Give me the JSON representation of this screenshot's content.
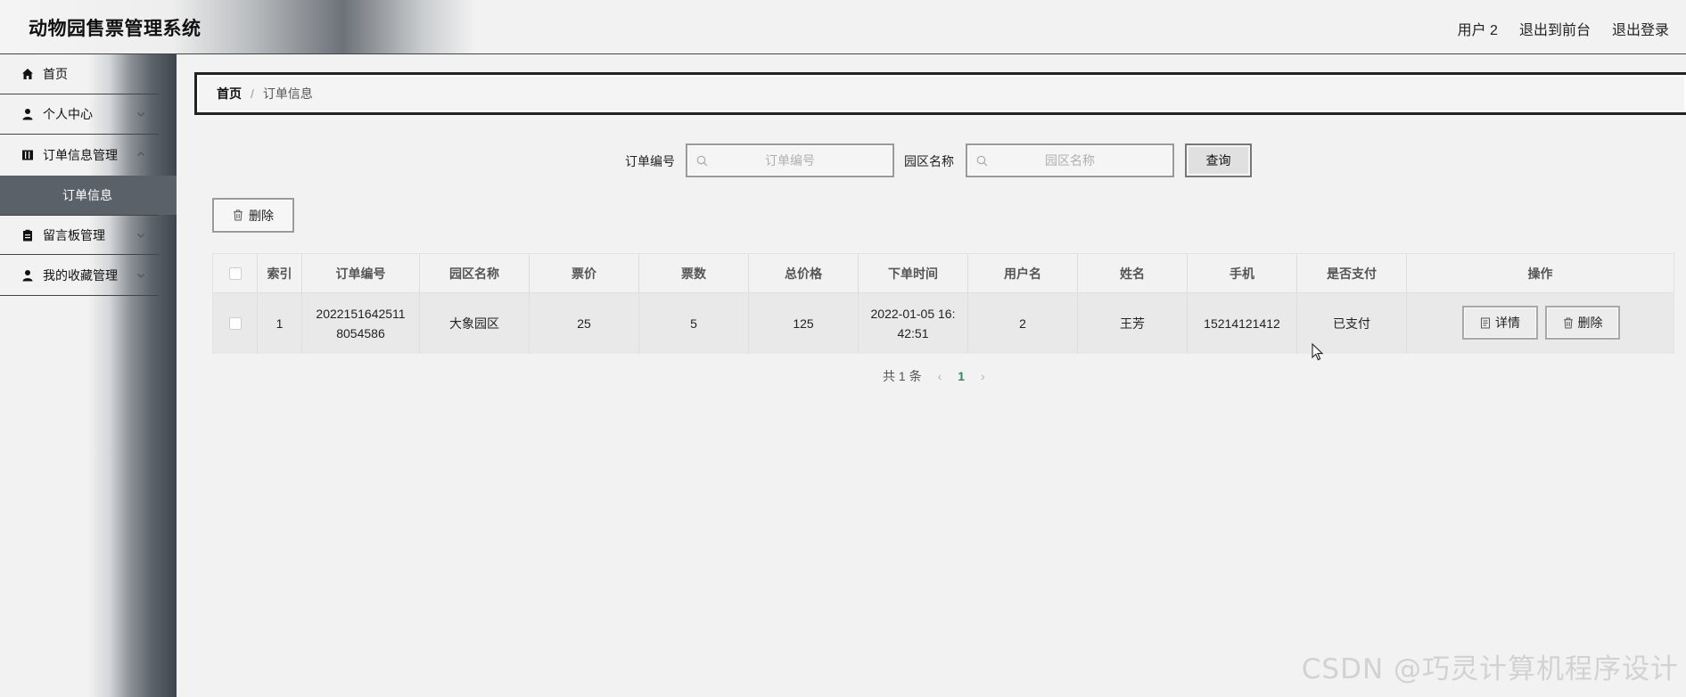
{
  "header": {
    "title": "动物园售票管理系统",
    "links": [
      "用户 2",
      "退出到前台",
      "退出登录"
    ]
  },
  "sidebar": {
    "items": [
      {
        "label": "首页",
        "icon": "home-icon"
      },
      {
        "label": "个人中心",
        "icon": "user-icon"
      },
      {
        "label": "订单信息管理",
        "icon": "book-icon"
      },
      {
        "label": "留言板管理",
        "icon": "clipboard-icon"
      },
      {
        "label": "我的收藏管理",
        "icon": "user-icon"
      }
    ],
    "active_subitem": "订单信息"
  },
  "breadcrumb": {
    "home": "首页",
    "separator": "/",
    "current": "订单信息"
  },
  "search": {
    "order_label": "订单编号",
    "order_placeholder": "订单编号",
    "park_label": "园区名称",
    "park_placeholder": "园区名称",
    "query_button": "查询"
  },
  "toolbar": {
    "delete_label": "删除"
  },
  "table": {
    "columns": [
      "索引",
      "订单编号",
      "园区名称",
      "票价",
      "票数",
      "总价格",
      "下单时间",
      "用户名",
      "姓名",
      "手机",
      "是否支付",
      "操作"
    ],
    "rows": [
      {
        "index": "1",
        "order_no_line1": "2022151642511",
        "order_no_line2": "8054586",
        "park": "大象园区",
        "price": "25",
        "count": "5",
        "total": "125",
        "time_line1": "2022-01-05 16:",
        "time_line2": "42:51",
        "username": "2",
        "name": "王芳",
        "phone": "15214121412",
        "paid": "已支付",
        "detail_button": "详情",
        "delete_button": "删除"
      }
    ]
  },
  "pagination": {
    "total": "共 1 条",
    "current_page": "1"
  },
  "watermark": "CSDN @巧灵计算机程序设计",
  "colors": {
    "page_bg": "#f2f2f2",
    "sidebar_active_bg": "#5b6168",
    "pagination_active": "#2f8a57"
  }
}
